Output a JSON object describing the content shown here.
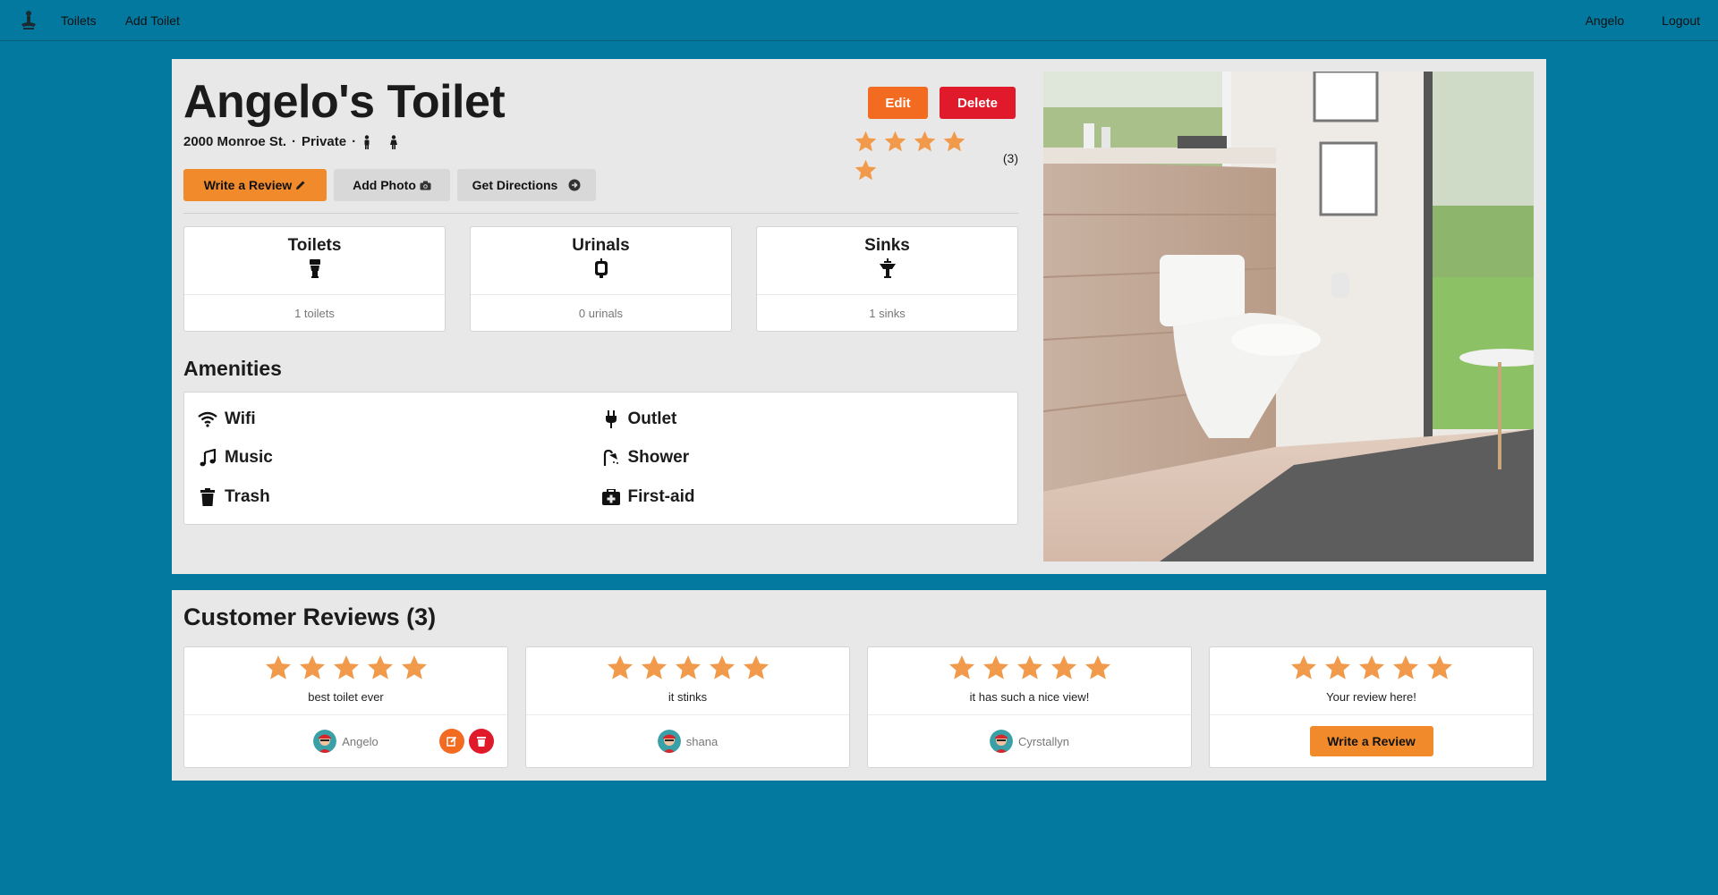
{
  "nav": {
    "logo_icon": "toilet-person-icon",
    "links": [
      "Toilets",
      "Add Toilet"
    ],
    "user": "Angelo",
    "logout": "Logout"
  },
  "toilet": {
    "title": "Angelo's Toilet",
    "address": "2000 Monroe St.",
    "access": "Private",
    "gender_icons": [
      "male-icon",
      "female-icon"
    ],
    "edit_label": "Edit",
    "delete_label": "Delete",
    "rating": 5,
    "rating_count": "(3)",
    "write_review_label": "Write a Review",
    "add_photo_label": "Add Photo",
    "directions_label": "Get Directions"
  },
  "counts": [
    {
      "label": "Toilets",
      "value": "1 toilets",
      "icon": "toilet-icon"
    },
    {
      "label": "Urinals",
      "value": "0 urinals",
      "icon": "urinal-icon"
    },
    {
      "label": "Sinks",
      "value": "1 sinks",
      "icon": "sink-icon"
    }
  ],
  "amenities_title": "Amenities",
  "amenities": [
    {
      "label": "Wifi",
      "icon": "wifi-icon"
    },
    {
      "label": "Outlet",
      "icon": "plug-icon"
    },
    {
      "label": "Music",
      "icon": "music-icon"
    },
    {
      "label": "Shower",
      "icon": "shower-icon"
    },
    {
      "label": "Trash",
      "icon": "trash-icon"
    },
    {
      "label": "First-aid",
      "icon": "first-aid-icon"
    }
  ],
  "reviews": {
    "title": "Customer Reviews (3)",
    "items": [
      {
        "text": "best toilet ever",
        "user": "Angelo",
        "stars": 5
      },
      {
        "text": "it stinks",
        "user": "shana",
        "stars": 5
      },
      {
        "text": "it has such a nice view!",
        "user": "Cyrstallyn",
        "stars": 5
      }
    ],
    "prompt_text": "Your review here!",
    "prompt_button": "Write a Review"
  },
  "colors": {
    "page_bg": "#03799f",
    "panel_bg": "#e8e8e8",
    "star": "#f19a4c",
    "orange": "#f26b21",
    "red": "#e0192b"
  }
}
